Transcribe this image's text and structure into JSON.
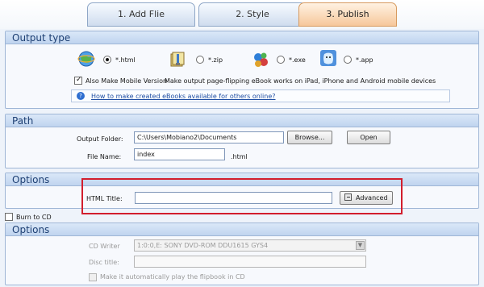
{
  "tabs": [
    {
      "label": "1. Add Flie"
    },
    {
      "label": "2. Style"
    },
    {
      "label": "3. Publish"
    }
  ],
  "output_type": {
    "title": "Output type",
    "options": [
      {
        "label": "*.html",
        "icon": "globe-icon",
        "selected": true
      },
      {
        "label": "*.zip",
        "icon": "zip-icon",
        "selected": false
      },
      {
        "label": "*.exe",
        "icon": "exe-icon",
        "selected": false
      },
      {
        "label": "*.app",
        "icon": "mac-icon",
        "selected": false
      }
    ],
    "mobile_label": "Also Make Mobile Version",
    "mobile_desc": "Make output page-flipping eBook works on iPad, iPhone and Android mobile devices",
    "help_link": "How to make created eBooks available for others online?"
  },
  "path": {
    "title": "Path",
    "output_folder_label": "Output Folder:",
    "output_folder_value": "C:\\Users\\Mobiano2\\Documents",
    "browse_label": "Browse...",
    "open_label": "Open",
    "file_name_label": "File Name:",
    "file_name_value": "index",
    "file_ext": ".html"
  },
  "options_html": {
    "title": "Options",
    "html_title_label": "HTML Title:",
    "html_title_value": "",
    "advanced_label": "Advanced"
  },
  "burn": {
    "label": "Burn to CD",
    "checked": false
  },
  "options_cd": {
    "title": "Options",
    "cd_writer_label": "CD Writer",
    "cd_writer_value": "1:0:0,E: SONY    DVD-ROM DDU1615  GYS4",
    "disc_title_label": "Disc title:",
    "disc_title_value": "",
    "autoplay_label": "Make it automatically play the flipbook in CD"
  },
  "colors": {
    "active_tab": "#f6c79a",
    "section_header": "#bfd4ef",
    "highlight": "#d21e2d"
  }
}
